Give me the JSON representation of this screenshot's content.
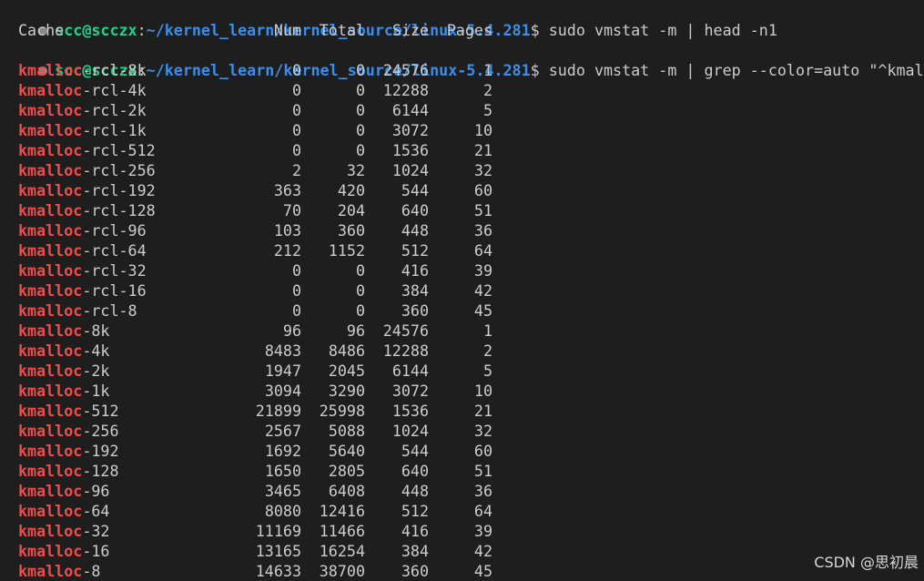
{
  "prompt": {
    "user": "scc@scczx",
    "sep": ":",
    "path": "~/kernel_learn/kernel_source/linux-5.4.281",
    "symbol": "$",
    "cmd1": " sudo vmstat -m | head -n1",
    "cmd2": " sudo vmstat -m | grep --color=auto \"^kmalloc\""
  },
  "header": {
    "cache": "Cache",
    "num": "Num",
    "total": "Total",
    "size": "Size",
    "pages": "Pages"
  },
  "match": "kmalloc",
  "rows": [
    {
      "rest": "-rcl-8k",
      "num": "0",
      "total": "0",
      "size": "24576",
      "pages": "1"
    },
    {
      "rest": "-rcl-4k",
      "num": "0",
      "total": "0",
      "size": "12288",
      "pages": "2"
    },
    {
      "rest": "-rcl-2k",
      "num": "0",
      "total": "0",
      "size": "6144",
      "pages": "5"
    },
    {
      "rest": "-rcl-1k",
      "num": "0",
      "total": "0",
      "size": "3072",
      "pages": "10"
    },
    {
      "rest": "-rcl-512",
      "num": "0",
      "total": "0",
      "size": "1536",
      "pages": "21"
    },
    {
      "rest": "-rcl-256",
      "num": "2",
      "total": "32",
      "size": "1024",
      "pages": "32"
    },
    {
      "rest": "-rcl-192",
      "num": "363",
      "total": "420",
      "size": "544",
      "pages": "60"
    },
    {
      "rest": "-rcl-128",
      "num": "70",
      "total": "204",
      "size": "640",
      "pages": "51"
    },
    {
      "rest": "-rcl-96",
      "num": "103",
      "total": "360",
      "size": "448",
      "pages": "36"
    },
    {
      "rest": "-rcl-64",
      "num": "212",
      "total": "1152",
      "size": "512",
      "pages": "64"
    },
    {
      "rest": "-rcl-32",
      "num": "0",
      "total": "0",
      "size": "416",
      "pages": "39"
    },
    {
      "rest": "-rcl-16",
      "num": "0",
      "total": "0",
      "size": "384",
      "pages": "42"
    },
    {
      "rest": "-rcl-8",
      "num": "0",
      "total": "0",
      "size": "360",
      "pages": "45"
    },
    {
      "rest": "-8k",
      "num": "96",
      "total": "96",
      "size": "24576",
      "pages": "1"
    },
    {
      "rest": "-4k",
      "num": "8483",
      "total": "8486",
      "size": "12288",
      "pages": "2"
    },
    {
      "rest": "-2k",
      "num": "1947",
      "total": "2045",
      "size": "6144",
      "pages": "5"
    },
    {
      "rest": "-1k",
      "num": "3094",
      "total": "3290",
      "size": "3072",
      "pages": "10"
    },
    {
      "rest": "-512",
      "num": "21899",
      "total": "25998",
      "size": "1536",
      "pages": "21"
    },
    {
      "rest": "-256",
      "num": "2567",
      "total": "5088",
      "size": "1024",
      "pages": "32"
    },
    {
      "rest": "-192",
      "num": "1692",
      "total": "5640",
      "size": "544",
      "pages": "60"
    },
    {
      "rest": "-128",
      "num": "1650",
      "total": "2805",
      "size": "640",
      "pages": "51"
    },
    {
      "rest": "-96",
      "num": "3465",
      "total": "6408",
      "size": "448",
      "pages": "36"
    },
    {
      "rest": "-64",
      "num": "8080",
      "total": "12416",
      "size": "512",
      "pages": "64"
    },
    {
      "rest": "-32",
      "num": "11169",
      "total": "11466",
      "size": "416",
      "pages": "39"
    },
    {
      "rest": "-16",
      "num": "13165",
      "total": "16254",
      "size": "384",
      "pages": "42"
    },
    {
      "rest": "-8",
      "num": "14633",
      "total": "38700",
      "size": "360",
      "pages": "45"
    }
  ],
  "watermark": "CSDN @思初晨"
}
